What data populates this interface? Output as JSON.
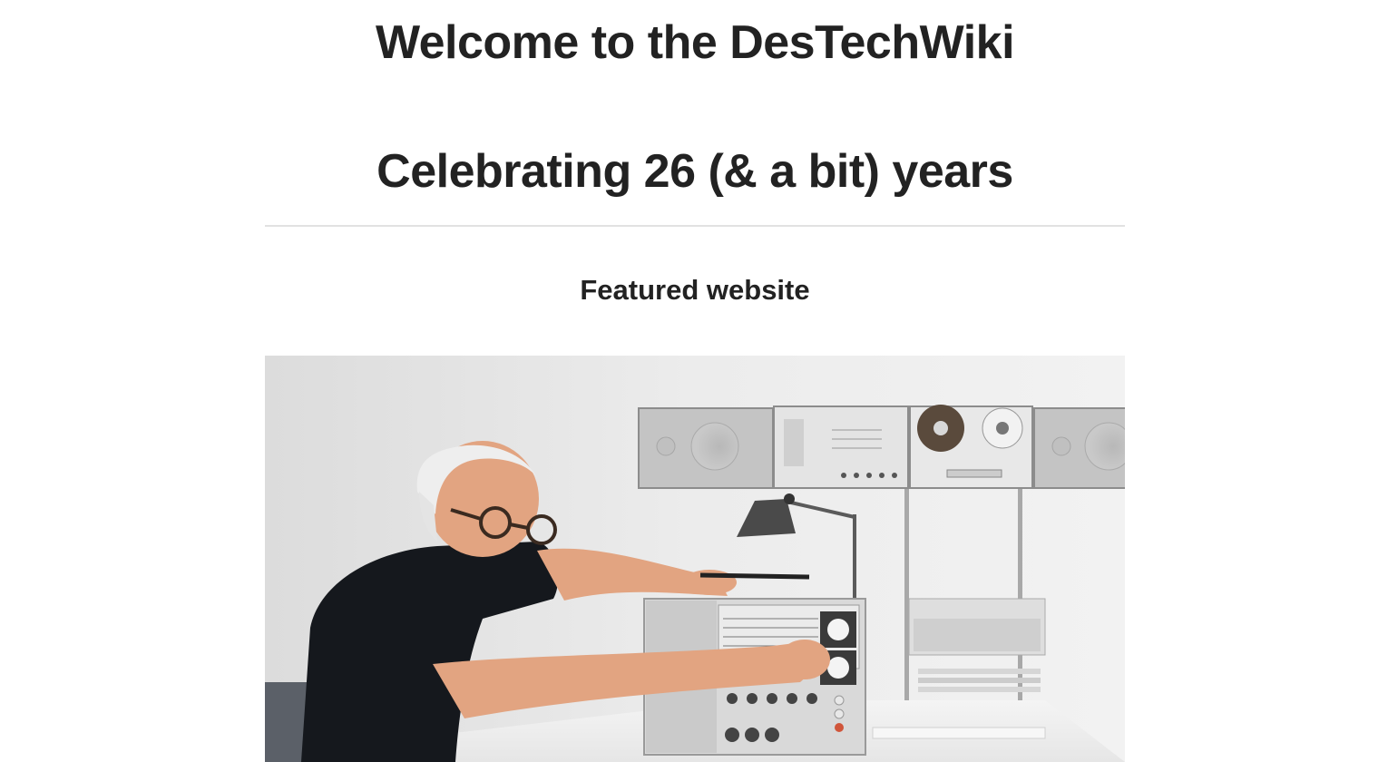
{
  "header": {
    "title": "Welcome to the DesTechWiki",
    "subtitle": "Celebrating 26 (& a bit) years"
  },
  "featured": {
    "heading": "Featured website"
  }
}
